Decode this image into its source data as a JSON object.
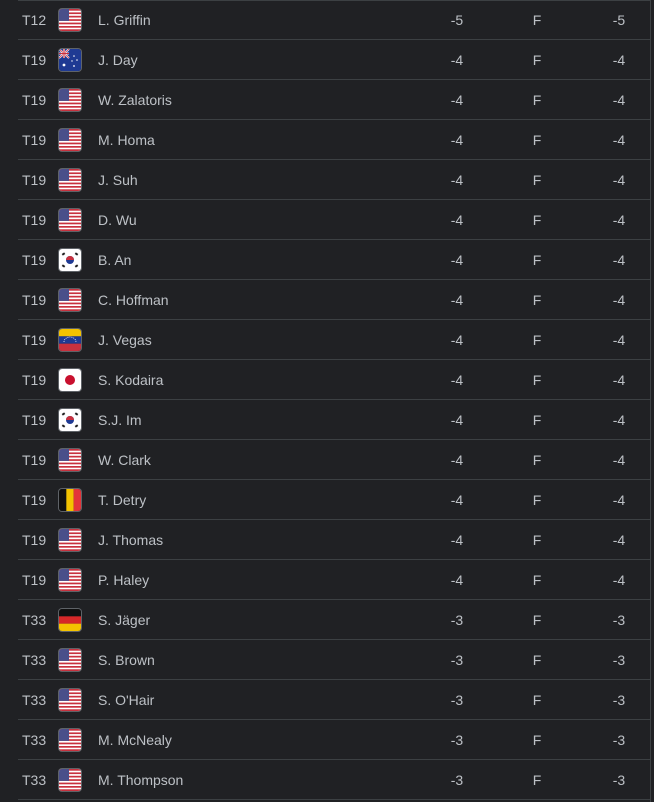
{
  "leaderboard": {
    "rows": [
      {
        "position": "T12",
        "flag": "usa-flag-icon",
        "country": "USA",
        "player": "L. Griffin",
        "today": "-5",
        "thru": "F",
        "total": "-5"
      },
      {
        "position": "T19",
        "flag": "australia-flag-icon",
        "country": "AUS",
        "player": "J. Day",
        "today": "-4",
        "thru": "F",
        "total": "-4"
      },
      {
        "position": "T19",
        "flag": "usa-flag-icon",
        "country": "USA",
        "player": "W. Zalatoris",
        "today": "-4",
        "thru": "F",
        "total": "-4"
      },
      {
        "position": "T19",
        "flag": "usa-flag-icon",
        "country": "USA",
        "player": "M. Homa",
        "today": "-4",
        "thru": "F",
        "total": "-4"
      },
      {
        "position": "T19",
        "flag": "usa-flag-icon",
        "country": "USA",
        "player": "J. Suh",
        "today": "-4",
        "thru": "F",
        "total": "-4"
      },
      {
        "position": "T19",
        "flag": "usa-flag-icon",
        "country": "USA",
        "player": "D. Wu",
        "today": "-4",
        "thru": "F",
        "total": "-4"
      },
      {
        "position": "T19",
        "flag": "south-korea-flag-icon",
        "country": "KOR",
        "player": "B. An",
        "today": "-4",
        "thru": "F",
        "total": "-4"
      },
      {
        "position": "T19",
        "flag": "usa-flag-icon",
        "country": "USA",
        "player": "C. Hoffman",
        "today": "-4",
        "thru": "F",
        "total": "-4"
      },
      {
        "position": "T19",
        "flag": "venezuela-flag-icon",
        "country": "VEN",
        "player": "J. Vegas",
        "today": "-4",
        "thru": "F",
        "total": "-4"
      },
      {
        "position": "T19",
        "flag": "japan-flag-icon",
        "country": "JPN",
        "player": "S. Kodaira",
        "today": "-4",
        "thru": "F",
        "total": "-4"
      },
      {
        "position": "T19",
        "flag": "south-korea-flag-icon",
        "country": "KOR",
        "player": "S.J. Im",
        "today": "-4",
        "thru": "F",
        "total": "-4"
      },
      {
        "position": "T19",
        "flag": "usa-flag-icon",
        "country": "USA",
        "player": "W. Clark",
        "today": "-4",
        "thru": "F",
        "total": "-4"
      },
      {
        "position": "T19",
        "flag": "belgium-flag-icon",
        "country": "BEL",
        "player": "T. Detry",
        "today": "-4",
        "thru": "F",
        "total": "-4"
      },
      {
        "position": "T19",
        "flag": "usa-flag-icon",
        "country": "USA",
        "player": "J. Thomas",
        "today": "-4",
        "thru": "F",
        "total": "-4"
      },
      {
        "position": "T19",
        "flag": "usa-flag-icon",
        "country": "USA",
        "player": "P. Haley",
        "today": "-4",
        "thru": "F",
        "total": "-4"
      },
      {
        "position": "T33",
        "flag": "germany-flag-icon",
        "country": "GER",
        "player": "S. Jäger",
        "today": "-3",
        "thru": "F",
        "total": "-3"
      },
      {
        "position": "T33",
        "flag": "usa-flag-icon",
        "country": "USA",
        "player": "S. Brown",
        "today": "-3",
        "thru": "F",
        "total": "-3"
      },
      {
        "position": "T33",
        "flag": "usa-flag-icon",
        "country": "USA",
        "player": "S. O'Hair",
        "today": "-3",
        "thru": "F",
        "total": "-3"
      },
      {
        "position": "T33",
        "flag": "usa-flag-icon",
        "country": "USA",
        "player": "M. McNealy",
        "today": "-3",
        "thru": "F",
        "total": "-3"
      },
      {
        "position": "T33",
        "flag": "usa-flag-icon",
        "country": "USA",
        "player": "M. Thompson",
        "today": "-3",
        "thru": "F",
        "total": "-3"
      }
    ]
  },
  "colors": {
    "background": "#202124",
    "text": "#bdc1c6",
    "divider": "#3c4043"
  }
}
